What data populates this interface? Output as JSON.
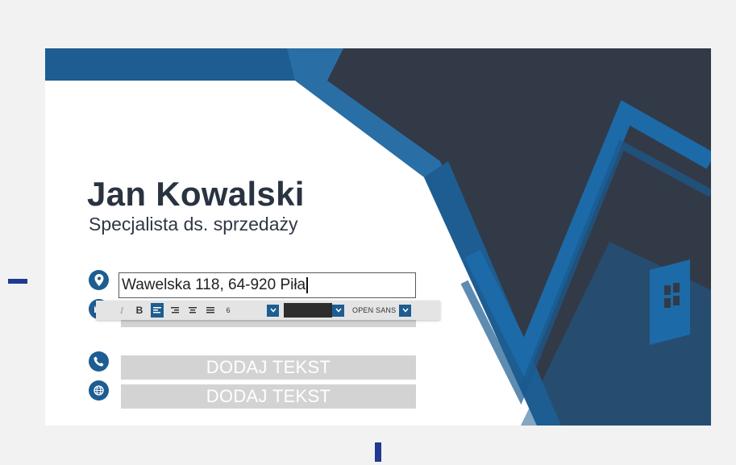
{
  "card": {
    "name": "Jan Kowalski",
    "job_title": "Specjalista ds. sprzedaży",
    "address": "Wawelska 118, 64-920 Piła",
    "fields": [
      {
        "label": "DODAJ TEKST",
        "icon": "phone-icon"
      },
      {
        "label": "DODAJ TEKST",
        "icon": "globe-icon"
      }
    ]
  },
  "toolbar": {
    "italic_label": "I",
    "bold_label": "B",
    "font_size": "6",
    "font_family": "OPEN SANS"
  },
  "colors": {
    "accent_blue": "#1d5d92",
    "dark_navy": "#323a48",
    "placeholder_gray": "#d3d3d3"
  }
}
